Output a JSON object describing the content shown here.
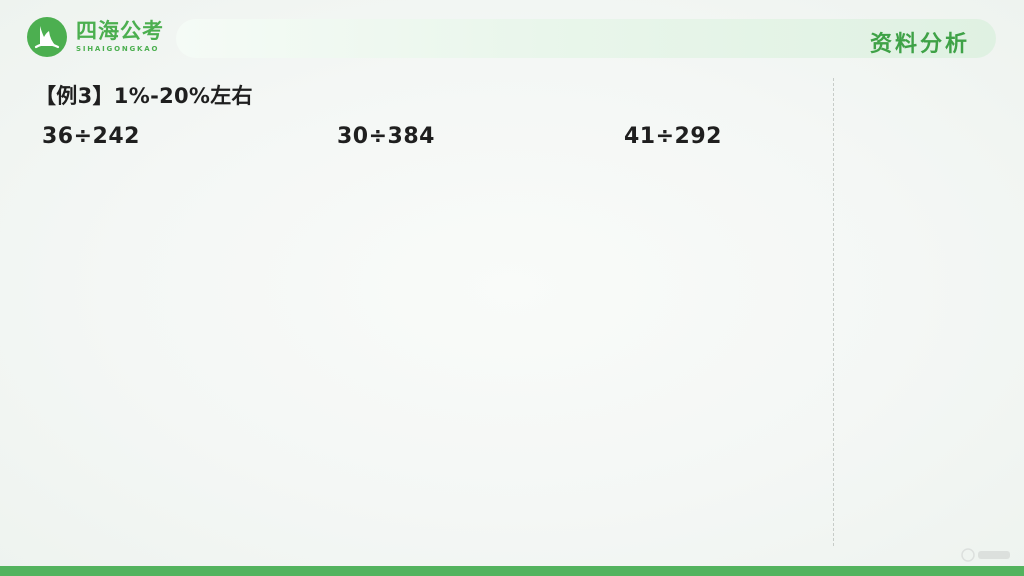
{
  "logo": {
    "name_cn": "四海公考",
    "name_en": "SIHAIGONGKAO"
  },
  "header": {
    "section_title": "资料分析"
  },
  "example": {
    "heading": "【例3】1%-20%左右",
    "formulas": [
      "36÷242",
      "30÷384",
      "41÷292"
    ]
  },
  "icons": {
    "logo": "sail-logo-icon",
    "watermark": "watermark-icon"
  },
  "colors": {
    "brand_green": "#4caf50",
    "section_green": "#3fa247",
    "bottom_bar": "#53b35e"
  }
}
